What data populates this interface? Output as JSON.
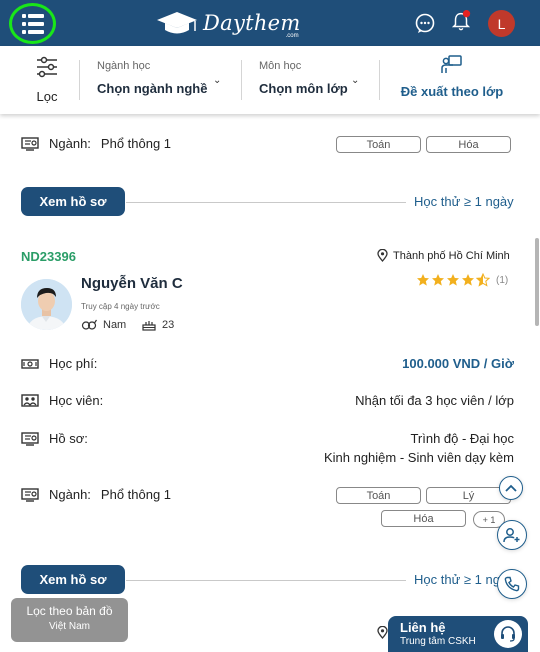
{
  "header": {
    "brand": "Daythem",
    "brand_sub": ".com",
    "avatar_letter": "L",
    "icons": [
      "menu-icon",
      "chat-icon",
      "bell-icon"
    ],
    "colors": {
      "bar": "#1f4e79",
      "menu_ring": "#19e619",
      "avatar": "#c0392b",
      "badge": "#e52222"
    }
  },
  "filter": {
    "filter_label": "Lọc",
    "major": {
      "caption": "Ngành học",
      "value": "Chọn ngành nghề"
    },
    "subject": {
      "caption": "Môn học",
      "value": "Chọn môn lớp"
    },
    "suggest": "Đề xuất theo lớp"
  },
  "card_prev": {
    "major_label": "Ngành:",
    "major_value": "Phổ thông 1",
    "subjects": [
      "Toán",
      "Hóa"
    ],
    "profile_button": "Xem hồ sơ",
    "trial": "Học thử ≥ 1 ngày"
  },
  "tutor": {
    "id": "ND23396",
    "city": "Thành phố Hồ Chí Minh",
    "name": "Nguyễn Văn C",
    "last_access": "Truy cập 4 ngày trước",
    "gender": "Nam",
    "age": "23",
    "rating": 4.5,
    "rating_count": "(1)",
    "fee_label": "Học phí:",
    "fee_value": "100.000 VND / Giờ",
    "students_label": "Học viên:",
    "students_value": "Nhận tối đa 3 học viên / lớp",
    "profile_label": "Hồ sơ:",
    "profile_level": "Trình độ - Đại học",
    "profile_exp": "Kinh nghiệm - Sinh viên dạy kèm",
    "major_label": "Ngành:",
    "major_value": "Phổ thông 1",
    "subjects": [
      "Toán",
      "Lý",
      "Hóa"
    ],
    "more_subjects": "+ 1",
    "profile_button": "Xem hồ sơ",
    "trial": "Học thử ≥ 1 ngày"
  },
  "floating": {
    "map_title": "Lọc theo bản đồ",
    "map_sub": "Việt Nam",
    "contact_title": "Liên hệ",
    "contact_sub": "Trung tâm CSKH"
  }
}
